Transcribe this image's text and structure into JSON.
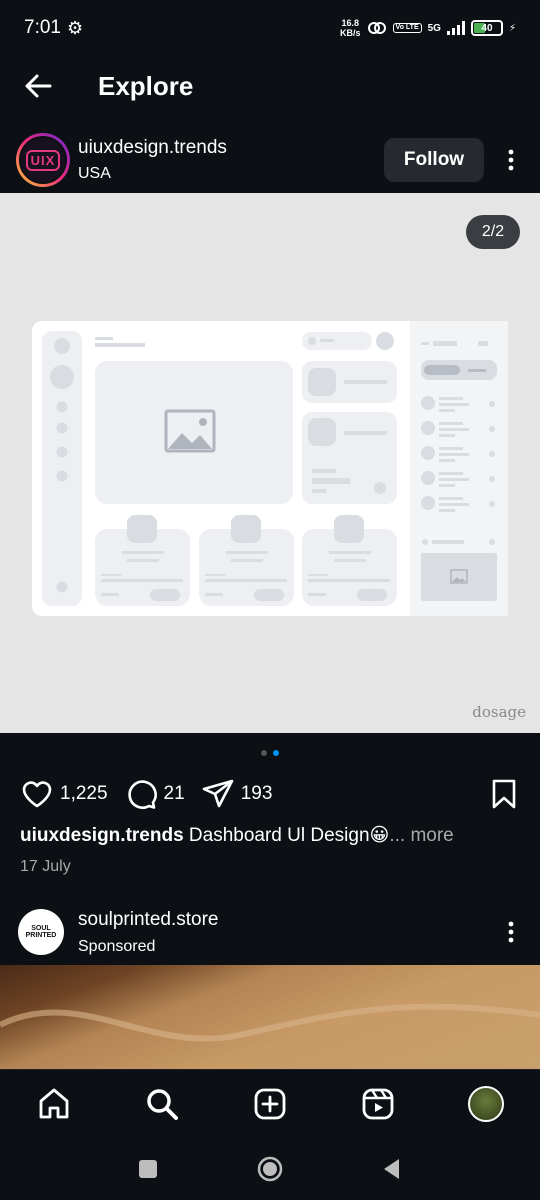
{
  "status_bar": {
    "time": "7:01",
    "net_speed_value": "16.8",
    "net_speed_unit": "KB/s",
    "volte": "Vo LTE",
    "network": "5G",
    "battery": "40"
  },
  "header": {
    "title": "Explore",
    "back_icon": "arrow-left-icon"
  },
  "post": {
    "author": "uiuxdesign.trends",
    "avatar_text": "UIX",
    "location": "USA",
    "follow_label": "Follow",
    "page_counter": "2/2",
    "watermark": "dosage",
    "carousel_active": 2,
    "carousel_total": 2,
    "likes": "1,225",
    "comments": "21",
    "shares": "193",
    "caption_author": "uiuxdesign.trends",
    "caption_text": " Dashboard Ul Design😀",
    "caption_more": "... more",
    "date": "17 July"
  },
  "sponsored": {
    "name": "soulprinted.store",
    "label": "Sponsored",
    "avatar_text": "SOUL PRINTED"
  },
  "bottom_nav": [
    "home-icon",
    "search-icon",
    "create-icon",
    "reels-icon",
    "profile-avatar"
  ],
  "colors": {
    "background": "#0c1014",
    "accent_blue": "#0095f6",
    "follow_button": "#262a30"
  }
}
